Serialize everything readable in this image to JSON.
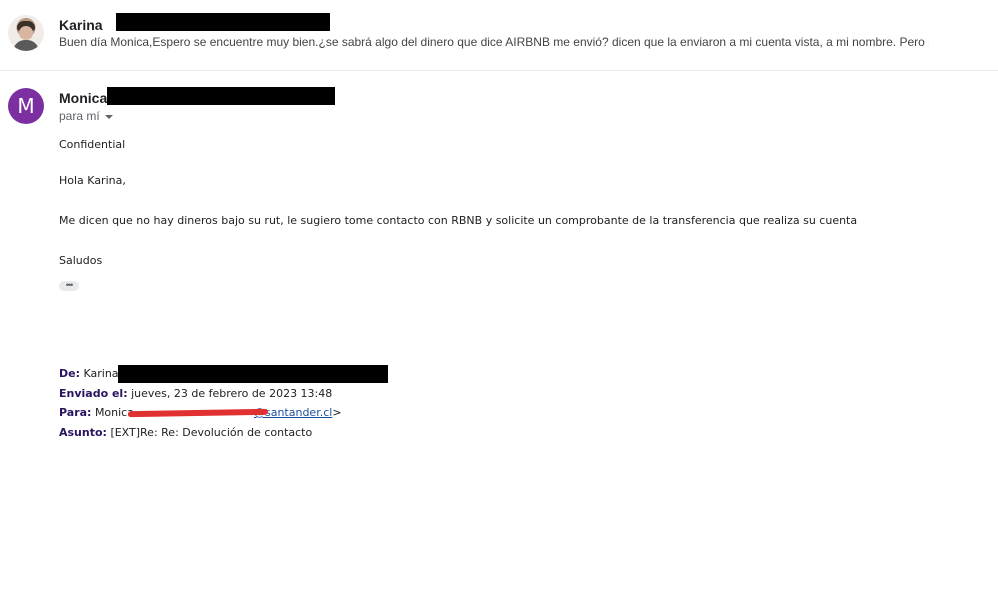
{
  "thread": {
    "first_message": {
      "sender_name": "Karina",
      "snippet": "Buen día Monica,Espero se encuentre muy bien.¿se sabrá algo del dinero que dice AIRBNB me envió? dicen que la enviaron a mi cuenta vista, a mi nombre. Pero no t"
    },
    "second_message": {
      "avatar_letter": "M",
      "sender_name": "Monica",
      "recipient_label": "para mí",
      "confidential_label": "Confidential",
      "greeting": "Hola Karina,",
      "paragraph": "Me dicen que no hay dineros bajo su rut, le sugiero tome contacto con RBNB y solicite un comprobante de la transferencia que realiza su cuenta",
      "signoff": "Saludos",
      "show_trimmed_label": "•••",
      "quoted_header": {
        "from_label": "De:",
        "from_value": "Karina",
        "sent_label": "Enviado el:",
        "sent_value": "jueves, 23 de febrero de 2023 13:48",
        "to_label": "Para:",
        "to_value": "Monica",
        "to_email": "@santander.cl",
        "to_close": ">",
        "subject_label": "Asunto:",
        "subject_value": "[EXT]Re: Re: Devolución de contacto"
      }
    }
  },
  "colors": {
    "avatar_purple": "#7b2fa0",
    "header_label": "#2a1460",
    "link": "#1a4f9c",
    "redaction": "#000000",
    "scribble": "#e03030"
  }
}
